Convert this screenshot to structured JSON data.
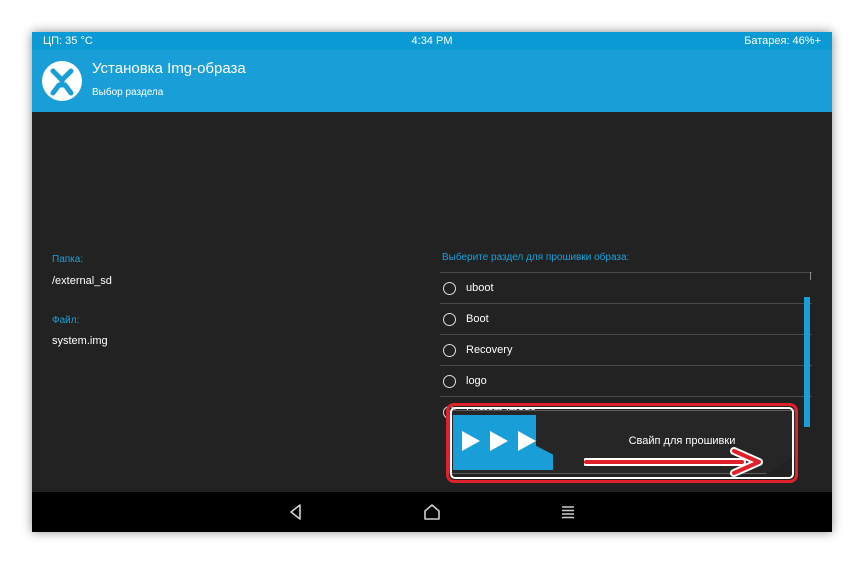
{
  "status_bar": {
    "cpu": "ЦП: 35 °C",
    "time": "4:34 PM",
    "battery": "Батарея: 46%+"
  },
  "header": {
    "title": "Установка Img-образа",
    "subtitle": "Выбор раздела",
    "logo_icon": "twrp-logo-icon"
  },
  "folder": {
    "label": "Папка:",
    "value": "/external_sd"
  },
  "file": {
    "label": "Файл:",
    "value": "system.img"
  },
  "partitions": {
    "header": "Выберите раздел для прошивки образа:",
    "items": [
      {
        "label": "uboot",
        "selected": false
      },
      {
        "label": "Boot",
        "selected": false
      },
      {
        "label": "Recovery",
        "selected": false
      },
      {
        "label": "logo",
        "selected": false
      },
      {
        "label": "System Image",
        "selected": true
      }
    ]
  },
  "swipe": {
    "label": "Свайп для прошивки",
    "handle_icon": "triple-play-arrows-icon"
  },
  "annotation": {
    "highlight_color": "#e0202a",
    "arrow_color": "#e0202a"
  },
  "nav": {
    "back_icon": "back-triangle-icon",
    "home_icon": "home-icon",
    "menu_icon": "menu-icon"
  },
  "colors": {
    "accent": "#1a9ed8",
    "background": "#222222",
    "navbar": "#000000"
  }
}
